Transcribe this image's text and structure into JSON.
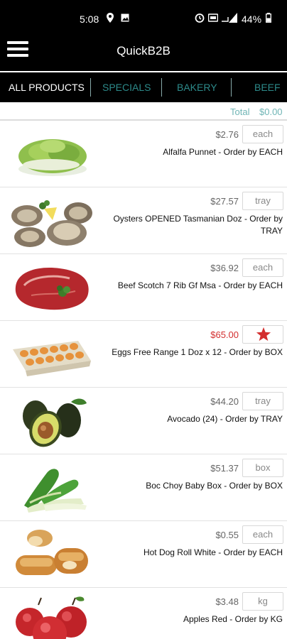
{
  "status_bar": {
    "time": "5:08",
    "battery": "44%"
  },
  "header": {
    "title": "QuickB2B"
  },
  "tabs": [
    {
      "label": "ALL PRODUCTS",
      "active": true
    },
    {
      "label": "SPECIALS",
      "active": false
    },
    {
      "label": "BAKERY",
      "active": false
    },
    {
      "label": "BEEF",
      "active": false
    }
  ],
  "total": {
    "label": "Total",
    "value": "$0.00"
  },
  "products": [
    {
      "price": "$2.76",
      "unit": "each",
      "name": "Alfalfa Punnet - Order by EACH",
      "image": "sprouts"
    },
    {
      "price": "$27.57",
      "unit": "tray",
      "name": "Oysters OPENED Tasmanian Doz - Order by TRAY",
      "image": "oysters"
    },
    {
      "price": "$36.92",
      "unit": "each",
      "name": "Beef Scotch 7 Rib Gf Msa - Order by EACH",
      "image": "steak"
    },
    {
      "price": "$65.00",
      "unit": "",
      "name": "Eggs Free Range 1 Doz x 12 - Order by BOX",
      "image": "eggs",
      "special": true,
      "special_color": "#d32f2f"
    },
    {
      "price": "$44.20",
      "unit": "tray",
      "name": "Avocado (24) - Order by TRAY",
      "image": "avocado"
    },
    {
      "price": "$51.37",
      "unit": "box",
      "name": "Boc Choy Baby Box - Order by BOX",
      "image": "bokchoy"
    },
    {
      "price": "$0.55",
      "unit": "each",
      "name": "Hot Dog Roll White - Order by EACH",
      "image": "bread"
    },
    {
      "price": "$3.48",
      "unit": "kg",
      "name": "Apples Red - Order by KG",
      "image": "apples"
    }
  ]
}
